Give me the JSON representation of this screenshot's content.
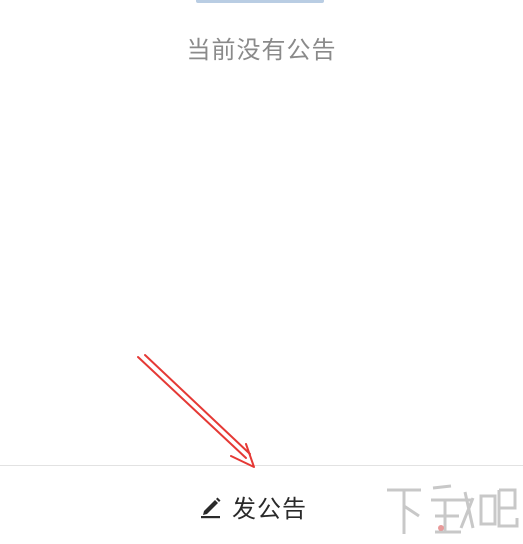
{
  "empty_state": {
    "message": "当前没有公告"
  },
  "bottom_bar": {
    "post_label": "发公告",
    "post_icon": "pencil-icon"
  },
  "annotation": {
    "color": "#e53935"
  },
  "watermark": {
    "text": "下载吧",
    "icon": "watermark-logo"
  }
}
